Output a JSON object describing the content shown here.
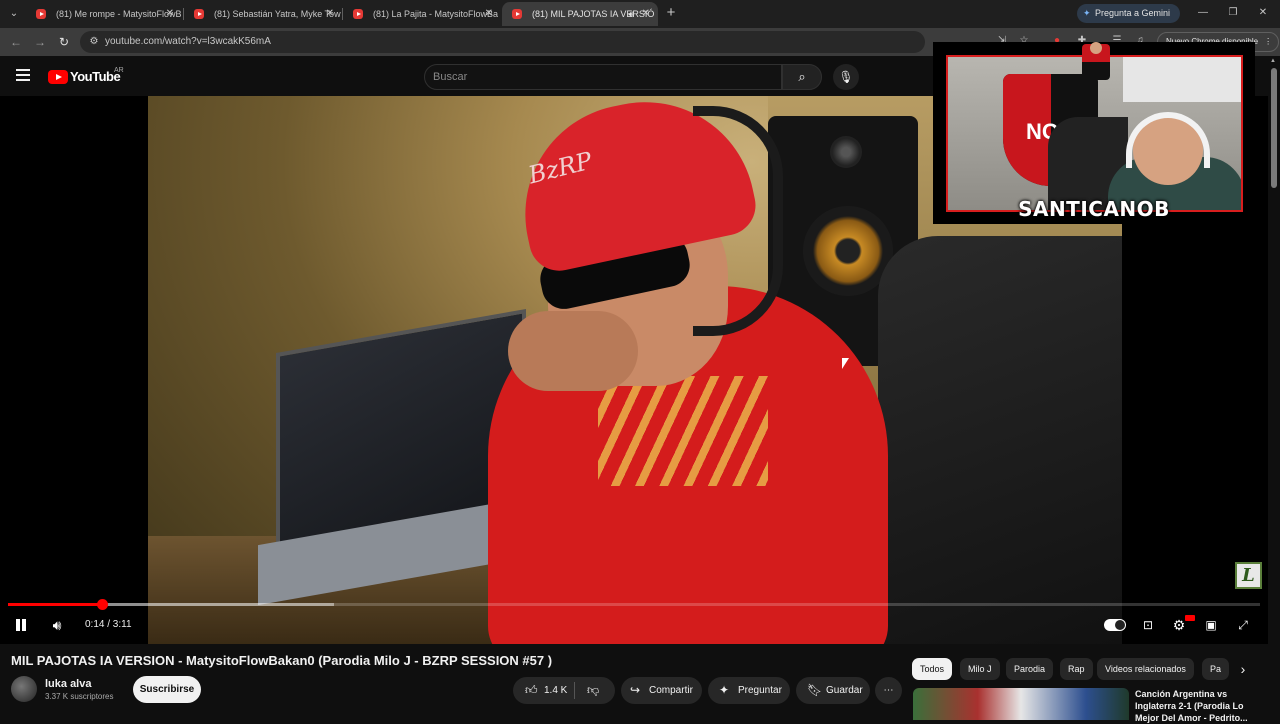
{
  "browser": {
    "tabs": [
      {
        "title": "(81) Me rompe - MatysitoFlowB",
        "active": false
      },
      {
        "title": "(81) Sebastián Yatra, Myke Tow",
        "active": false
      },
      {
        "title": "(81) La Pajita - MatysitoFlowBa",
        "active": false
      },
      {
        "title": "(81) MIL PAJOTAS IA VERSIÓ",
        "active": true
      }
    ],
    "gemini_label": "Pregunta a Gemini",
    "url": "youtube.com/watch?v=l3wcakK56mA",
    "update_label": "Nuevo Chrome disponible"
  },
  "youtube": {
    "logo_text": "YouTube",
    "country_code": "AR",
    "search_placeholder": "Buscar"
  },
  "player": {
    "time_current": "0:14",
    "time_total": "3:11",
    "time_display": "0:14 / 3:11",
    "played_fraction": 0.075,
    "buffered_fraction": 0.26,
    "watermark_letter": "L",
    "video_cap_text": "BzRP"
  },
  "overlay": {
    "streamer_name": "SANTICANOB",
    "shield_text": "NOB"
  },
  "video": {
    "title": "MIL PAJOTAS IA VERSION - MatysitoFlowBakan0 (Parodia Milo J - BZRP SESSION #57 )",
    "channel_name": "luka alva",
    "subscribers": "3.37 K suscriptores",
    "subscribe_label": "Suscribirse",
    "like_count": "1.4 K",
    "share_label": "Compartir",
    "ask_label": "Preguntar",
    "save_label": "Guardar"
  },
  "sidebar": {
    "chips": [
      "Todos",
      "Milo J",
      "Parodia",
      "Rap",
      "Videos relacionados",
      "Pa"
    ],
    "recommendation_title": "Canción Argentina vs Inglaterra 2-1 (Parodia Lo Mejor Del Amor - Pedrito..."
  },
  "colors": {
    "accent_red": "#ff0000",
    "background": "#0f0f0f",
    "pip_border": "#d81e1e"
  }
}
